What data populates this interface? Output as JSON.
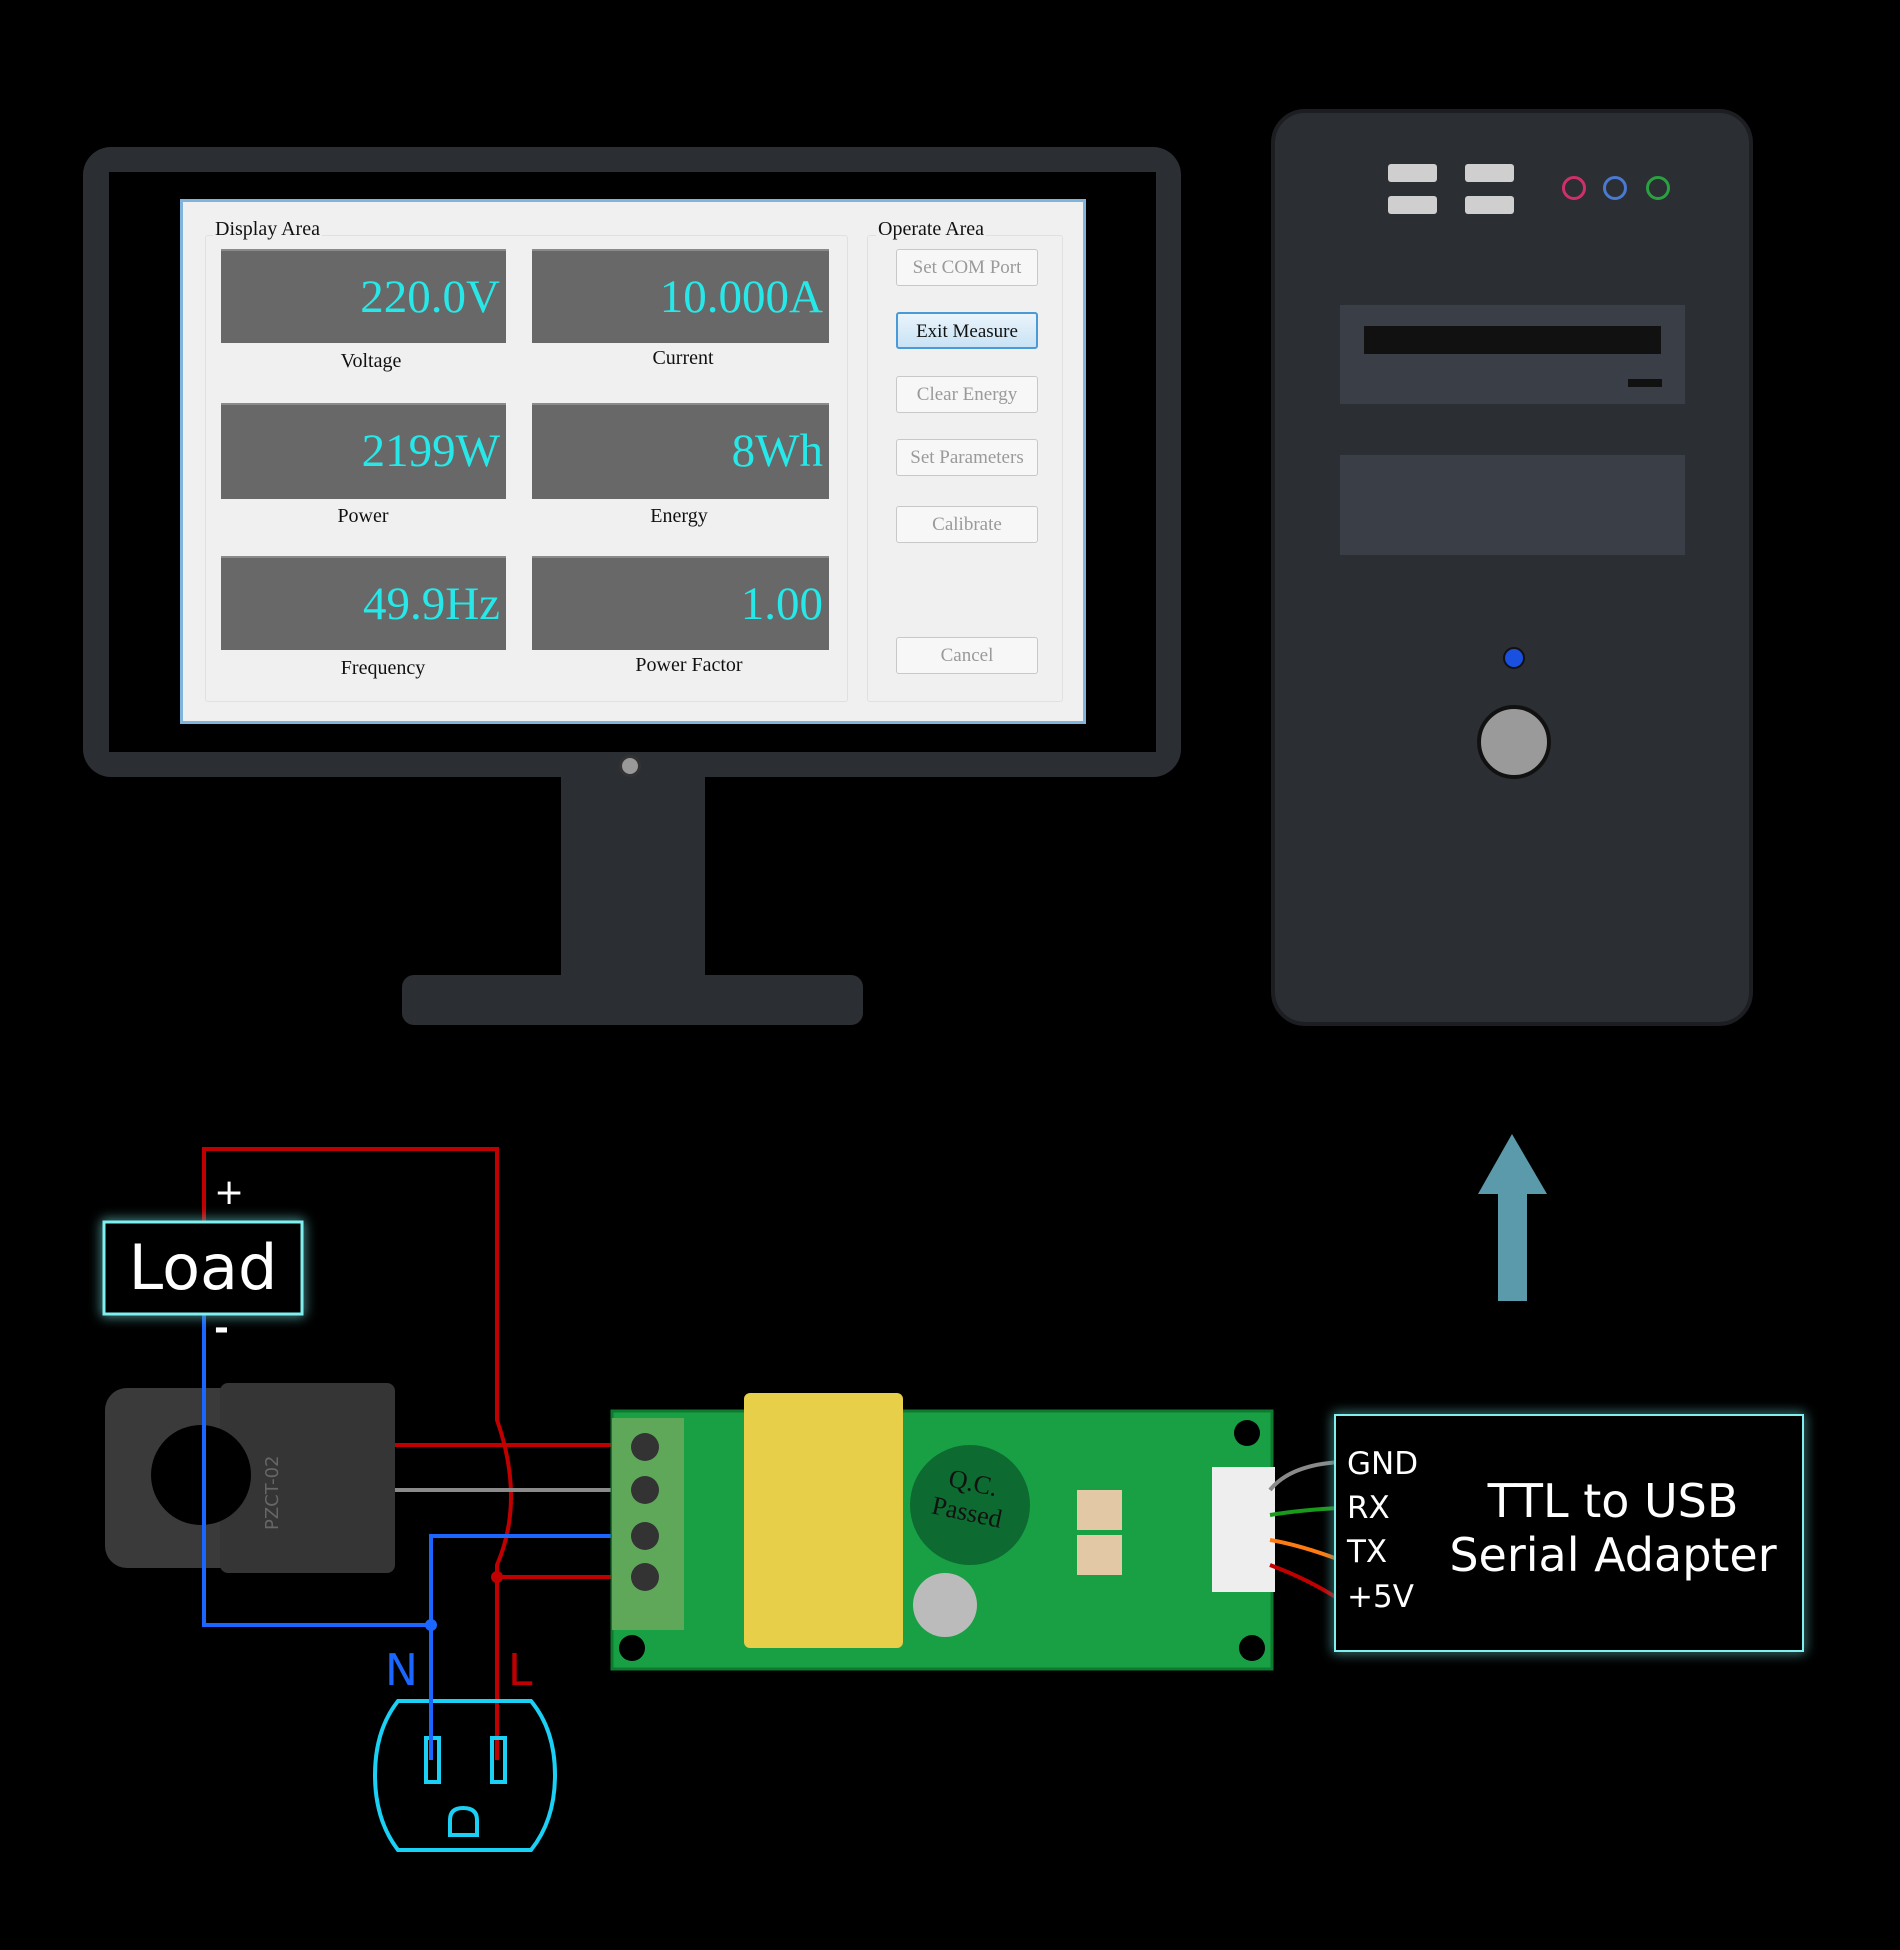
{
  "app": {
    "display_area_label": "Display Area",
    "operate_area_label": "Operate Area",
    "readings": [
      {
        "value": "220.0V",
        "label": "Voltage"
      },
      {
        "value": "10.000A",
        "label": "Current"
      },
      {
        "value": "2199W",
        "label": "Power"
      },
      {
        "value": "8Wh",
        "label": "Energy"
      },
      {
        "value": "49.9Hz",
        "label": "Frequency"
      },
      {
        "value": "1.00",
        "label": "Power Factor"
      }
    ],
    "buttons": [
      {
        "label": "Set COM Port",
        "enabled": false
      },
      {
        "label": "Exit Measure",
        "enabled": true,
        "focused": true
      },
      {
        "label": "Clear Energy",
        "enabled": false
      },
      {
        "label": "Set Parameters",
        "enabled": false
      },
      {
        "label": "Calibrate",
        "enabled": false
      },
      {
        "label": "Cancel",
        "enabled": false
      }
    ]
  },
  "diagram": {
    "load_label": "Load",
    "plus": "+",
    "minus": "-",
    "neutral": "N",
    "live": "L",
    "adapter": {
      "title_line1": "TTL to USB",
      "title_line2": "Serial Adapter",
      "pins": [
        "GND",
        "RX",
        "TX",
        "+5V"
      ]
    },
    "qc_sticker": "Q.C. Passed",
    "ct_label": "PZCT-02"
  },
  "colors": {
    "live_wire": "#c00000",
    "neutral_wire": "#1a66ff",
    "signal_wire": "#8a8a8a",
    "outlet": "#1ad0f5",
    "arrow": "#5a9aaa",
    "glow_box": "#7ff0f0",
    "reading_text": "#27e8e8"
  }
}
